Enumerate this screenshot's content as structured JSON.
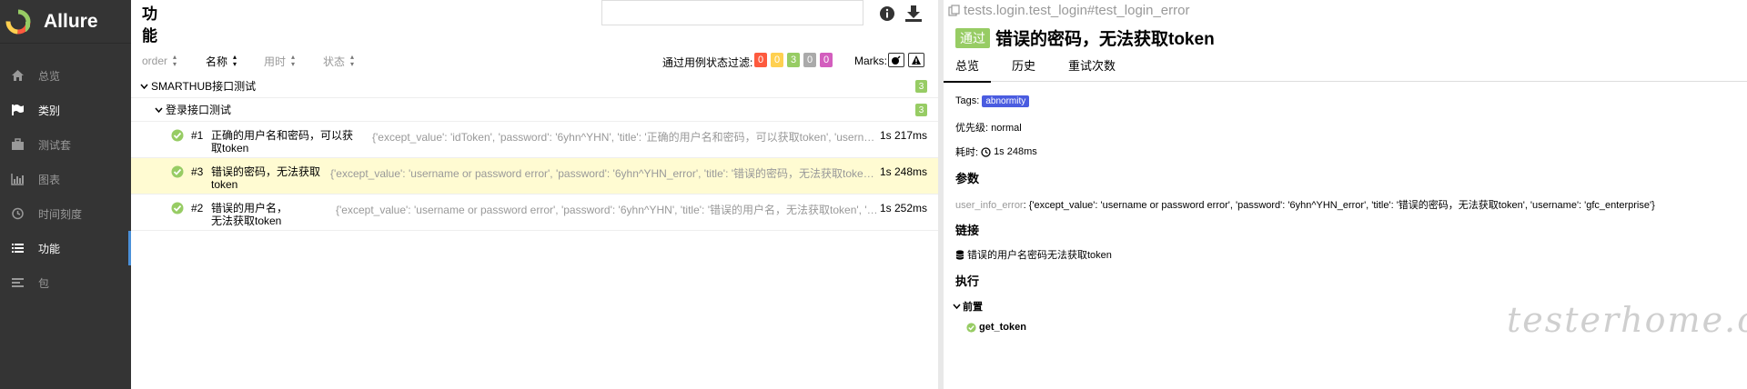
{
  "brand": {
    "title": "Allure"
  },
  "nav": [
    {
      "label": "总览",
      "icon": "home-icon"
    },
    {
      "label": "类别",
      "icon": "flag-icon"
    },
    {
      "label": "测试套",
      "icon": "briefcase-icon"
    },
    {
      "label": "图表",
      "icon": "bar-chart-icon"
    },
    {
      "label": "时间刻度",
      "icon": "clock-icon"
    },
    {
      "label": "功能",
      "icon": "list-icon"
    },
    {
      "label": "包",
      "icon": "align-left-icon"
    }
  ],
  "tree_pane": {
    "title": "功能",
    "search_placeholder": "",
    "sort": {
      "order": "order",
      "name": "名称",
      "duration": "用时",
      "status": "状态"
    },
    "filter_label": "通过用例状态过滤:",
    "status_counts": [
      {
        "value": "0",
        "color": "#fd5a3e"
      },
      {
        "value": "0",
        "color": "#ffd050"
      },
      {
        "value": "3",
        "color": "#97cc64"
      },
      {
        "value": "0",
        "color": "#aaaaaa"
      },
      {
        "value": "0",
        "color": "#d35ebe"
      }
    ],
    "marks_label": "Marks:",
    "groups": [
      {
        "name": "SMARTHUB接口测试",
        "count": "3"
      },
      {
        "name": "登录接口测试",
        "count": "3"
      }
    ],
    "tests": [
      {
        "num": "#1",
        "name": "正确的用户名和密码，可以获取token",
        "params": "{'except_value': 'idToken', 'password': '6yhn^YHN', 'title': '正确的用户名和密码，可以获取token', 'username': 'gfc_enterprise'}",
        "duration": "1s 217ms"
      },
      {
        "num": "#3",
        "name": "错误的密码，无法获取token",
        "params": "{'except_value': 'username or password error', 'password': '6yhn^YHN_error', 'title': '错误的密码，无法获取token', 'username': 'gfc_enterprise'}",
        "duration": "1s 248ms"
      },
      {
        "num": "#2",
        "name": "错误的用户名，无法获取token",
        "params": "{'except_value': 'username or password error', 'password': '6yhn^YHN', 'title': '错误的用户名，无法获取token', 'username': 'gfc'}",
        "duration": "1s 252ms"
      }
    ]
  },
  "detail": {
    "crumb": "tests.login.test_login#test_login_error",
    "status_label": "通过",
    "title": "错误的密码，无法获取token",
    "tabs": [
      "总览",
      "历史",
      "重试次数"
    ],
    "tags_label": "Tags:",
    "tag": "abnormity",
    "severity": "优先级: normal",
    "duration_label": "耗时:",
    "duration": "1s 248ms",
    "params_head": "参数",
    "param_name": "user_info_error",
    "param_value": ": {'except_value': 'username or password error', 'password': '6yhn^YHN_error', 'title': '错误的密码，无法获取token', 'username': 'gfc_enterprise'}",
    "links_head": "链接",
    "link": "错误的用户名密码无法获取token",
    "exec_head": "执行",
    "setup_label": "前置",
    "setup_step": "get_token"
  },
  "watermark": "testerhome.com",
  "colors": {
    "sidebar": "#343434",
    "passed": "#97cc64",
    "tag": "#4a5ce0",
    "selected_row": "#fffbd2"
  }
}
